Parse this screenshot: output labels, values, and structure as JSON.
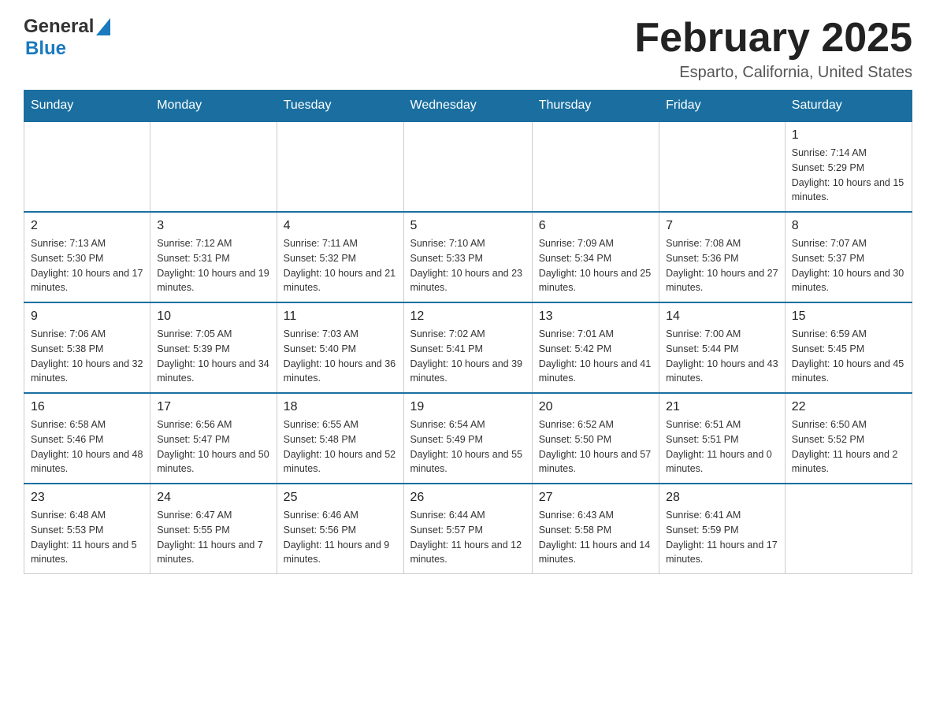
{
  "header": {
    "logo_general": "General",
    "logo_blue": "Blue",
    "month_title": "February 2025",
    "location": "Esparto, California, United States"
  },
  "weekdays": [
    "Sunday",
    "Monday",
    "Tuesday",
    "Wednesday",
    "Thursday",
    "Friday",
    "Saturday"
  ],
  "weeks": [
    [
      {
        "day": "",
        "info": ""
      },
      {
        "day": "",
        "info": ""
      },
      {
        "day": "",
        "info": ""
      },
      {
        "day": "",
        "info": ""
      },
      {
        "day": "",
        "info": ""
      },
      {
        "day": "",
        "info": ""
      },
      {
        "day": "1",
        "info": "Sunrise: 7:14 AM\nSunset: 5:29 PM\nDaylight: 10 hours and 15 minutes."
      }
    ],
    [
      {
        "day": "2",
        "info": "Sunrise: 7:13 AM\nSunset: 5:30 PM\nDaylight: 10 hours and 17 minutes."
      },
      {
        "day": "3",
        "info": "Sunrise: 7:12 AM\nSunset: 5:31 PM\nDaylight: 10 hours and 19 minutes."
      },
      {
        "day": "4",
        "info": "Sunrise: 7:11 AM\nSunset: 5:32 PM\nDaylight: 10 hours and 21 minutes."
      },
      {
        "day": "5",
        "info": "Sunrise: 7:10 AM\nSunset: 5:33 PM\nDaylight: 10 hours and 23 minutes."
      },
      {
        "day": "6",
        "info": "Sunrise: 7:09 AM\nSunset: 5:34 PM\nDaylight: 10 hours and 25 minutes."
      },
      {
        "day": "7",
        "info": "Sunrise: 7:08 AM\nSunset: 5:36 PM\nDaylight: 10 hours and 27 minutes."
      },
      {
        "day": "8",
        "info": "Sunrise: 7:07 AM\nSunset: 5:37 PM\nDaylight: 10 hours and 30 minutes."
      }
    ],
    [
      {
        "day": "9",
        "info": "Sunrise: 7:06 AM\nSunset: 5:38 PM\nDaylight: 10 hours and 32 minutes."
      },
      {
        "day": "10",
        "info": "Sunrise: 7:05 AM\nSunset: 5:39 PM\nDaylight: 10 hours and 34 minutes."
      },
      {
        "day": "11",
        "info": "Sunrise: 7:03 AM\nSunset: 5:40 PM\nDaylight: 10 hours and 36 minutes."
      },
      {
        "day": "12",
        "info": "Sunrise: 7:02 AM\nSunset: 5:41 PM\nDaylight: 10 hours and 39 minutes."
      },
      {
        "day": "13",
        "info": "Sunrise: 7:01 AM\nSunset: 5:42 PM\nDaylight: 10 hours and 41 minutes."
      },
      {
        "day": "14",
        "info": "Sunrise: 7:00 AM\nSunset: 5:44 PM\nDaylight: 10 hours and 43 minutes."
      },
      {
        "day": "15",
        "info": "Sunrise: 6:59 AM\nSunset: 5:45 PM\nDaylight: 10 hours and 45 minutes."
      }
    ],
    [
      {
        "day": "16",
        "info": "Sunrise: 6:58 AM\nSunset: 5:46 PM\nDaylight: 10 hours and 48 minutes."
      },
      {
        "day": "17",
        "info": "Sunrise: 6:56 AM\nSunset: 5:47 PM\nDaylight: 10 hours and 50 minutes."
      },
      {
        "day": "18",
        "info": "Sunrise: 6:55 AM\nSunset: 5:48 PM\nDaylight: 10 hours and 52 minutes."
      },
      {
        "day": "19",
        "info": "Sunrise: 6:54 AM\nSunset: 5:49 PM\nDaylight: 10 hours and 55 minutes."
      },
      {
        "day": "20",
        "info": "Sunrise: 6:52 AM\nSunset: 5:50 PM\nDaylight: 10 hours and 57 minutes."
      },
      {
        "day": "21",
        "info": "Sunrise: 6:51 AM\nSunset: 5:51 PM\nDaylight: 11 hours and 0 minutes."
      },
      {
        "day": "22",
        "info": "Sunrise: 6:50 AM\nSunset: 5:52 PM\nDaylight: 11 hours and 2 minutes."
      }
    ],
    [
      {
        "day": "23",
        "info": "Sunrise: 6:48 AM\nSunset: 5:53 PM\nDaylight: 11 hours and 5 minutes."
      },
      {
        "day": "24",
        "info": "Sunrise: 6:47 AM\nSunset: 5:55 PM\nDaylight: 11 hours and 7 minutes."
      },
      {
        "day": "25",
        "info": "Sunrise: 6:46 AM\nSunset: 5:56 PM\nDaylight: 11 hours and 9 minutes."
      },
      {
        "day": "26",
        "info": "Sunrise: 6:44 AM\nSunset: 5:57 PM\nDaylight: 11 hours and 12 minutes."
      },
      {
        "day": "27",
        "info": "Sunrise: 6:43 AM\nSunset: 5:58 PM\nDaylight: 11 hours and 14 minutes."
      },
      {
        "day": "28",
        "info": "Sunrise: 6:41 AM\nSunset: 5:59 PM\nDaylight: 11 hours and 17 minutes."
      },
      {
        "day": "",
        "info": ""
      }
    ]
  ]
}
